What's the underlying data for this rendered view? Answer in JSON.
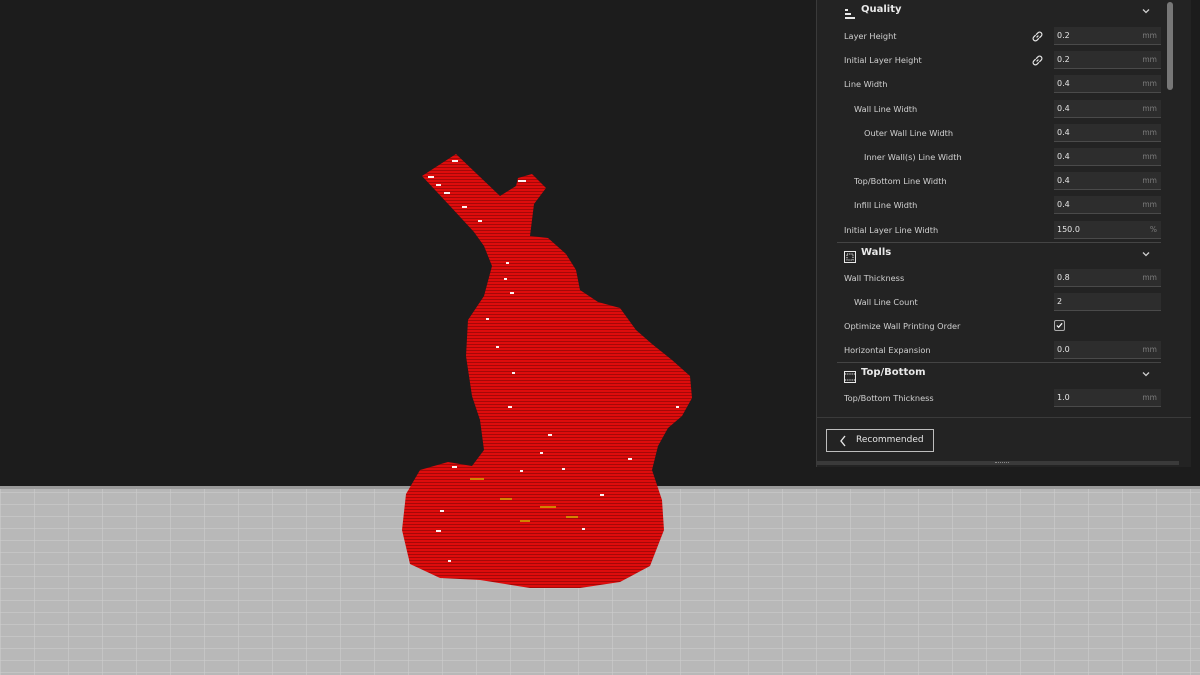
{
  "colors": {
    "background": "#1c1c1c",
    "build_plate": "#b6b6b6",
    "model": "#dc0d0d",
    "panel": "#232323"
  },
  "viewport": {
    "model_name": ""
  },
  "settings": {
    "categories": [
      {
        "title": "Quality",
        "icon": "quality-icon",
        "rows": [
          {
            "label": "Layer Height",
            "indent": 0,
            "value": "0.2",
            "unit": "mm",
            "linked": true
          },
          {
            "label": "Initial Layer Height",
            "indent": 0,
            "value": "0.2",
            "unit": "mm",
            "linked": true
          },
          {
            "label": "Line Width",
            "indent": 0,
            "value": "0.4",
            "unit": "mm"
          },
          {
            "label": "Wall Line Width",
            "indent": 1,
            "value": "0.4",
            "unit": "mm"
          },
          {
            "label": "Outer Wall Line Width",
            "indent": 2,
            "value": "0.4",
            "unit": "mm"
          },
          {
            "label": "Inner Wall(s) Line Width",
            "indent": 2,
            "value": "0.4",
            "unit": "mm"
          },
          {
            "label": "Top/Bottom Line Width",
            "indent": 1,
            "value": "0.4",
            "unit": "mm"
          },
          {
            "label": "Infill Line Width",
            "indent": 1,
            "value": "0.4",
            "unit": "mm"
          },
          {
            "label": "Initial Layer Line Width",
            "indent": 0,
            "value": "150.0",
            "unit": "%"
          }
        ]
      },
      {
        "title": "Walls",
        "icon": "walls-icon",
        "rows": [
          {
            "label": "Wall Thickness",
            "indent": 0,
            "value": "0.8",
            "unit": "mm"
          },
          {
            "label": "Wall Line Count",
            "indent": 1,
            "value": "2",
            "unit": ""
          },
          {
            "label": "Optimize Wall Printing Order",
            "indent": 0,
            "checkbox": true,
            "checked": true
          },
          {
            "label": "Horizontal Expansion",
            "indent": 0,
            "value": "0.0",
            "unit": "mm"
          }
        ]
      },
      {
        "title": "Top/Bottom",
        "icon": "top-bottom-icon",
        "rows": [
          {
            "label": "Top/Bottom Thickness",
            "indent": 0,
            "value": "1.0",
            "unit": "mm"
          }
        ]
      }
    ]
  },
  "footer": {
    "recommended_label": "Recommended"
  }
}
